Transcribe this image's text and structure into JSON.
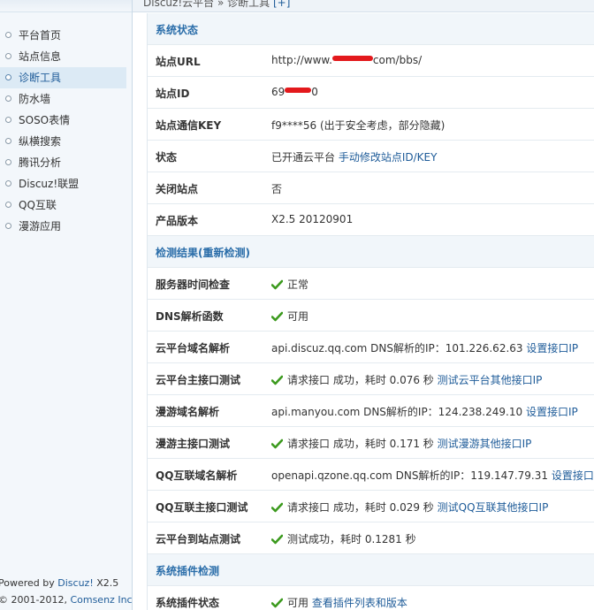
{
  "breadcrumb": {
    "text": "Discuz!云平台 » 诊断工具",
    "plus": "[+]"
  },
  "sidebar": {
    "items": [
      {
        "label": "平台首页"
      },
      {
        "label": "站点信息"
      },
      {
        "label": "诊断工具",
        "active": true
      },
      {
        "label": "防水墙"
      },
      {
        "label": "SOSO表情"
      },
      {
        "label": "纵横搜索"
      },
      {
        "label": "腾讯分析"
      },
      {
        "label": "Discuz!联盟"
      },
      {
        "label": "QQ互联"
      },
      {
        "label": "漫游应用"
      }
    ],
    "footer": {
      "powered_prefix": "Powered by ",
      "powered_link": "Discuz!",
      "version": " X2.5",
      "copyright_prefix": "© 2001-2012, ",
      "copyright_link": "Comsenz Inc."
    }
  },
  "system_status": {
    "title": "系统状态",
    "site_url_label": "站点URL",
    "site_url_prefix": "http://www.",
    "site_url_suffix": "com/bbs/",
    "site_id_label": "站点ID",
    "site_id_prefix": "69",
    "site_id_suffix": "0",
    "site_key_label": "站点通信KEY",
    "site_key_value": "f9****56 (出于安全考虑，部分隐藏)",
    "status_label": "状态",
    "status_value": "已开通云平台",
    "status_link": "手动修改站点ID/KEY",
    "close_label": "关闭站点",
    "close_value": "否",
    "version_label": "产品版本",
    "version_value": "X2.5 20120901"
  },
  "detect": {
    "title": "检测结果(重新检测)",
    "server_time_label": "服务器时间检查",
    "server_time_value": "正常",
    "dns_func_label": "DNS解析函数",
    "dns_func_value": "可用",
    "cloud_dns_label": "云平台域名解析",
    "cloud_dns_value": "api.discuz.qq.com DNS解析的IP：101.226.62.63",
    "cloud_dns_link": "设置接口IP",
    "cloud_api_label": "云平台主接口测试",
    "cloud_api_value": "请求接口 成功，耗时 0.076 秒",
    "cloud_api_link": "测试云平台其他接口IP",
    "manyou_dns_label": "漫游域名解析",
    "manyou_dns_value": "api.manyou.com DNS解析的IP：124.238.249.10",
    "manyou_dns_link": "设置接口IP",
    "manyou_api_label": "漫游主接口测试",
    "manyou_api_value": "请求接口 成功，耗时 0.171 秒",
    "manyou_api_link": "测试漫游其他接口IP",
    "qq_dns_label": "QQ互联域名解析",
    "qq_dns_value": "openapi.qzone.qq.com DNS解析的IP：119.147.79.31",
    "qq_dns_link": "设置接口IP",
    "qq_api_label": "QQ互联主接口测试",
    "qq_api_value": "请求接口 成功，耗时 0.029 秒",
    "qq_api_link": "测试QQ互联其他接口IP",
    "site_test_label": "云平台到站点测试",
    "site_test_value": "测试成功，耗时 0.1281 秒"
  },
  "plugin": {
    "title": "系统插件检测",
    "status_label": "系统插件状态",
    "status_value": "可用",
    "status_link": "查看插件列表和版本"
  },
  "colors": {
    "accent": "#2a6da9",
    "check": "#3c9a1e",
    "redact": "#e3191c"
  }
}
